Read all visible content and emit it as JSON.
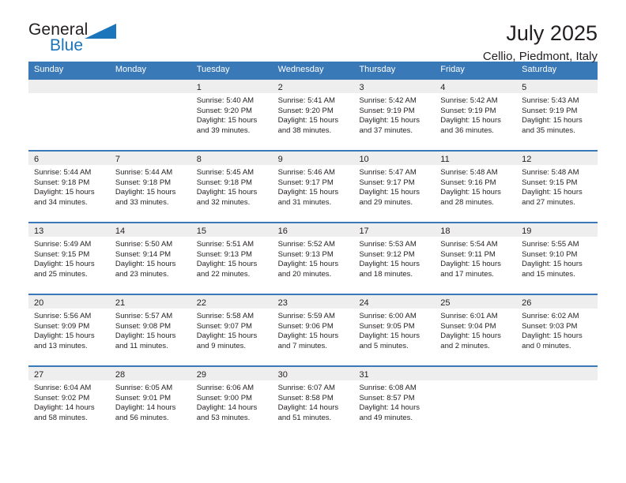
{
  "brand": {
    "name_part1": "General",
    "name_part2": "Blue",
    "logo_icon": "triangle-logo-icon",
    "accent_color": "#1b75bb"
  },
  "header": {
    "title": "July 2025",
    "location": "Cellio, Piedmont, Italy"
  },
  "theme": {
    "header_row_bg": "#3a79b8",
    "daynum_band_bg": "#efeeee",
    "week_separator": "#3a79b8",
    "text": "#231f20"
  },
  "weekdays": [
    "Sunday",
    "Monday",
    "Tuesday",
    "Wednesday",
    "Thursday",
    "Friday",
    "Saturday"
  ],
  "weeks": [
    [
      {
        "day": "",
        "sunrise": "",
        "sunset": "",
        "daylight_line1": "",
        "daylight_line2": ""
      },
      {
        "day": "",
        "sunrise": "",
        "sunset": "",
        "daylight_line1": "",
        "daylight_line2": ""
      },
      {
        "day": "1",
        "sunrise": "Sunrise: 5:40 AM",
        "sunset": "Sunset: 9:20 PM",
        "daylight_line1": "Daylight: 15 hours",
        "daylight_line2": "and 39 minutes."
      },
      {
        "day": "2",
        "sunrise": "Sunrise: 5:41 AM",
        "sunset": "Sunset: 9:20 PM",
        "daylight_line1": "Daylight: 15 hours",
        "daylight_line2": "and 38 minutes."
      },
      {
        "day": "3",
        "sunrise": "Sunrise: 5:42 AM",
        "sunset": "Sunset: 9:19 PM",
        "daylight_line1": "Daylight: 15 hours",
        "daylight_line2": "and 37 minutes."
      },
      {
        "day": "4",
        "sunrise": "Sunrise: 5:42 AM",
        "sunset": "Sunset: 9:19 PM",
        "daylight_line1": "Daylight: 15 hours",
        "daylight_line2": "and 36 minutes."
      },
      {
        "day": "5",
        "sunrise": "Sunrise: 5:43 AM",
        "sunset": "Sunset: 9:19 PM",
        "daylight_line1": "Daylight: 15 hours",
        "daylight_line2": "and 35 minutes."
      }
    ],
    [
      {
        "day": "6",
        "sunrise": "Sunrise: 5:44 AM",
        "sunset": "Sunset: 9:18 PM",
        "daylight_line1": "Daylight: 15 hours",
        "daylight_line2": "and 34 minutes."
      },
      {
        "day": "7",
        "sunrise": "Sunrise: 5:44 AM",
        "sunset": "Sunset: 9:18 PM",
        "daylight_line1": "Daylight: 15 hours",
        "daylight_line2": "and 33 minutes."
      },
      {
        "day": "8",
        "sunrise": "Sunrise: 5:45 AM",
        "sunset": "Sunset: 9:18 PM",
        "daylight_line1": "Daylight: 15 hours",
        "daylight_line2": "and 32 minutes."
      },
      {
        "day": "9",
        "sunrise": "Sunrise: 5:46 AM",
        "sunset": "Sunset: 9:17 PM",
        "daylight_line1": "Daylight: 15 hours",
        "daylight_line2": "and 31 minutes."
      },
      {
        "day": "10",
        "sunrise": "Sunrise: 5:47 AM",
        "sunset": "Sunset: 9:17 PM",
        "daylight_line1": "Daylight: 15 hours",
        "daylight_line2": "and 29 minutes."
      },
      {
        "day": "11",
        "sunrise": "Sunrise: 5:48 AM",
        "sunset": "Sunset: 9:16 PM",
        "daylight_line1": "Daylight: 15 hours",
        "daylight_line2": "and 28 minutes."
      },
      {
        "day": "12",
        "sunrise": "Sunrise: 5:48 AM",
        "sunset": "Sunset: 9:15 PM",
        "daylight_line1": "Daylight: 15 hours",
        "daylight_line2": "and 27 minutes."
      }
    ],
    [
      {
        "day": "13",
        "sunrise": "Sunrise: 5:49 AM",
        "sunset": "Sunset: 9:15 PM",
        "daylight_line1": "Daylight: 15 hours",
        "daylight_line2": "and 25 minutes."
      },
      {
        "day": "14",
        "sunrise": "Sunrise: 5:50 AM",
        "sunset": "Sunset: 9:14 PM",
        "daylight_line1": "Daylight: 15 hours",
        "daylight_line2": "and 23 minutes."
      },
      {
        "day": "15",
        "sunrise": "Sunrise: 5:51 AM",
        "sunset": "Sunset: 9:13 PM",
        "daylight_line1": "Daylight: 15 hours",
        "daylight_line2": "and 22 minutes."
      },
      {
        "day": "16",
        "sunrise": "Sunrise: 5:52 AM",
        "sunset": "Sunset: 9:13 PM",
        "daylight_line1": "Daylight: 15 hours",
        "daylight_line2": "and 20 minutes."
      },
      {
        "day": "17",
        "sunrise": "Sunrise: 5:53 AM",
        "sunset": "Sunset: 9:12 PM",
        "daylight_line1": "Daylight: 15 hours",
        "daylight_line2": "and 18 minutes."
      },
      {
        "day": "18",
        "sunrise": "Sunrise: 5:54 AM",
        "sunset": "Sunset: 9:11 PM",
        "daylight_line1": "Daylight: 15 hours",
        "daylight_line2": "and 17 minutes."
      },
      {
        "day": "19",
        "sunrise": "Sunrise: 5:55 AM",
        "sunset": "Sunset: 9:10 PM",
        "daylight_line1": "Daylight: 15 hours",
        "daylight_line2": "and 15 minutes."
      }
    ],
    [
      {
        "day": "20",
        "sunrise": "Sunrise: 5:56 AM",
        "sunset": "Sunset: 9:09 PM",
        "daylight_line1": "Daylight: 15 hours",
        "daylight_line2": "and 13 minutes."
      },
      {
        "day": "21",
        "sunrise": "Sunrise: 5:57 AM",
        "sunset": "Sunset: 9:08 PM",
        "daylight_line1": "Daylight: 15 hours",
        "daylight_line2": "and 11 minutes."
      },
      {
        "day": "22",
        "sunrise": "Sunrise: 5:58 AM",
        "sunset": "Sunset: 9:07 PM",
        "daylight_line1": "Daylight: 15 hours",
        "daylight_line2": "and 9 minutes."
      },
      {
        "day": "23",
        "sunrise": "Sunrise: 5:59 AM",
        "sunset": "Sunset: 9:06 PM",
        "daylight_line1": "Daylight: 15 hours",
        "daylight_line2": "and 7 minutes."
      },
      {
        "day": "24",
        "sunrise": "Sunrise: 6:00 AM",
        "sunset": "Sunset: 9:05 PM",
        "daylight_line1": "Daylight: 15 hours",
        "daylight_line2": "and 5 minutes."
      },
      {
        "day": "25",
        "sunrise": "Sunrise: 6:01 AM",
        "sunset": "Sunset: 9:04 PM",
        "daylight_line1": "Daylight: 15 hours",
        "daylight_line2": "and 2 minutes."
      },
      {
        "day": "26",
        "sunrise": "Sunrise: 6:02 AM",
        "sunset": "Sunset: 9:03 PM",
        "daylight_line1": "Daylight: 15 hours",
        "daylight_line2": "and 0 minutes."
      }
    ],
    [
      {
        "day": "27",
        "sunrise": "Sunrise: 6:04 AM",
        "sunset": "Sunset: 9:02 PM",
        "daylight_line1": "Daylight: 14 hours",
        "daylight_line2": "and 58 minutes."
      },
      {
        "day": "28",
        "sunrise": "Sunrise: 6:05 AM",
        "sunset": "Sunset: 9:01 PM",
        "daylight_line1": "Daylight: 14 hours",
        "daylight_line2": "and 56 minutes."
      },
      {
        "day": "29",
        "sunrise": "Sunrise: 6:06 AM",
        "sunset": "Sunset: 9:00 PM",
        "daylight_line1": "Daylight: 14 hours",
        "daylight_line2": "and 53 minutes."
      },
      {
        "day": "30",
        "sunrise": "Sunrise: 6:07 AM",
        "sunset": "Sunset: 8:58 PM",
        "daylight_line1": "Daylight: 14 hours",
        "daylight_line2": "and 51 minutes."
      },
      {
        "day": "31",
        "sunrise": "Sunrise: 6:08 AM",
        "sunset": "Sunset: 8:57 PM",
        "daylight_line1": "Daylight: 14 hours",
        "daylight_line2": "and 49 minutes."
      },
      {
        "day": "",
        "sunrise": "",
        "sunset": "",
        "daylight_line1": "",
        "daylight_line2": ""
      },
      {
        "day": "",
        "sunrise": "",
        "sunset": "",
        "daylight_line1": "",
        "daylight_line2": ""
      }
    ]
  ]
}
